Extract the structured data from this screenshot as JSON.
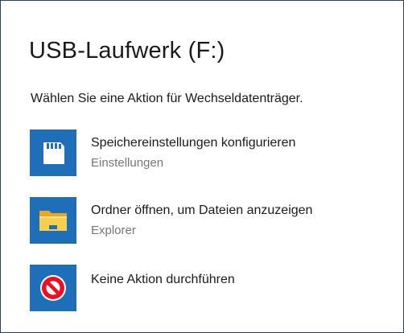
{
  "dialog": {
    "title": "USB-Laufwerk (F:)",
    "subtitle": "Wählen Sie eine Aktion für Wechseldatenträger."
  },
  "options": [
    {
      "label": "Speichereinstellungen konfigurieren",
      "sublabel": "Einstellungen",
      "icon": "sd-card-icon"
    },
    {
      "label": "Ordner öffnen, um Dateien anzuzeigen",
      "sublabel": "Explorer",
      "icon": "folder-icon"
    },
    {
      "label": "Keine Aktion durchführen",
      "icon": "no-action-icon"
    }
  ],
  "colors": {
    "tile_background": "#1e6fb8",
    "border": "#2b3f63",
    "secondary_text": "#767676"
  }
}
